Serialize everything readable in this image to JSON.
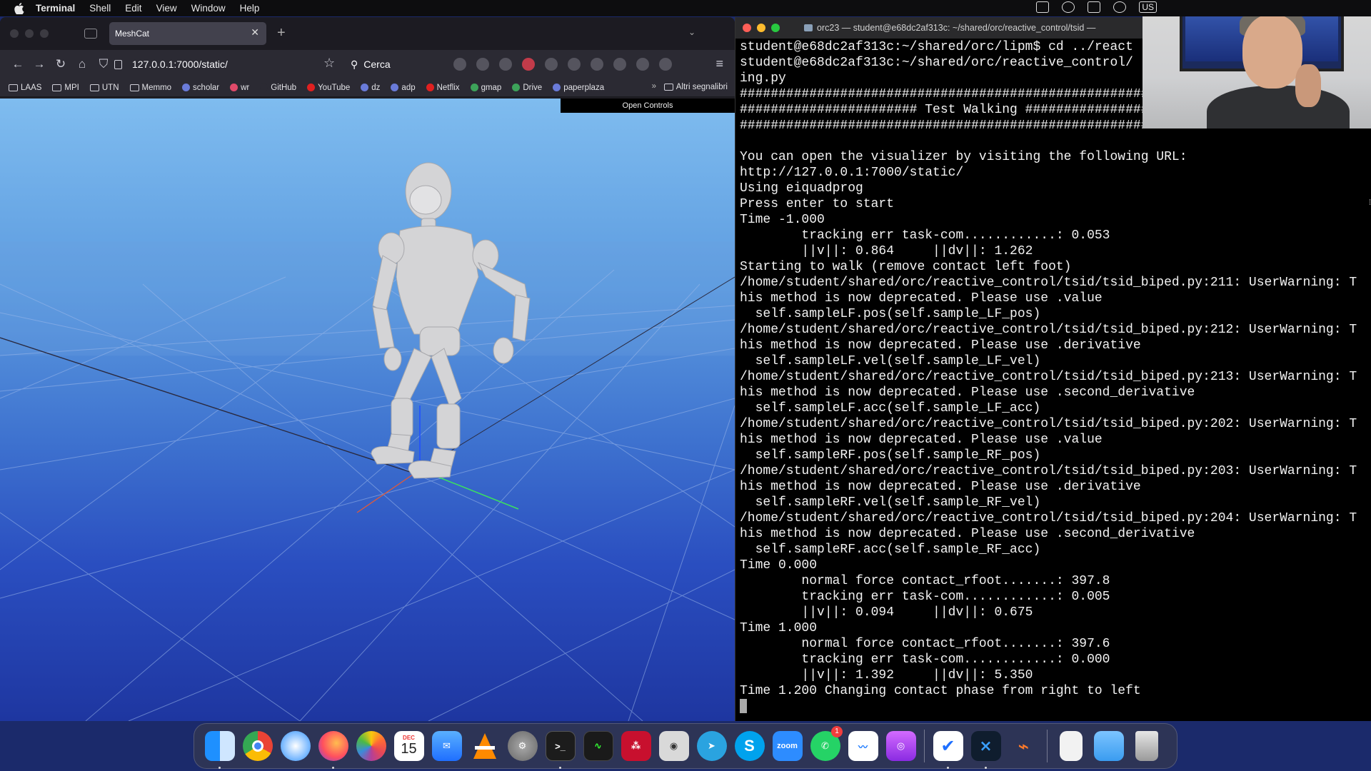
{
  "menubar": {
    "app_name": "Terminal",
    "items": [
      "Shell",
      "Edit",
      "View",
      "Window",
      "Help"
    ],
    "input_source": "US"
  },
  "browser": {
    "tab_title": "MeshCat",
    "url": "127.0.0.1:7000/static/",
    "search_placeholder": "Cerca",
    "bookmarks": [
      "LAAS",
      "MPI",
      "UTN",
      "Memmo",
      "scholar",
      "wr",
      "GitHub",
      "YouTube",
      "dz",
      "adp",
      "Netflix",
      "gmap",
      "Drive",
      "paperplaza"
    ],
    "other_bookmarks": "Altri segnalibri",
    "open_controls": "Open Controls"
  },
  "terminal": {
    "title": "orc23 — student@e68dc2af313c: ~/shared/orc/reactive_control/tsid —",
    "lines": [
      "student@e68dc2af313c:~/shared/orc/lipm$ cd ../react",
      "student@e68dc2af313c:~/shared/orc/reactive_control/",
      "ing.py",
      "##########################################################",
      "####################### Test Walking #####################",
      "##########################################################",
      "",
      "You can open the visualizer by visiting the following URL:",
      "http://127.0.0.1:7000/static/",
      "Using eiquadprog",
      "Press enter to start",
      "Time -1.000",
      "        tracking err task-com............: 0.053",
      "        ||v||: 0.864     ||dv||: 1.262",
      "Starting to walk (remove contact left foot)",
      "/home/student/shared/orc/reactive_control/tsid/tsid_biped.py:211: UserWarning: T",
      "his method is now deprecated. Please use .value",
      "  self.sampleLF.pos(self.sample_LF_pos)",
      "/home/student/shared/orc/reactive_control/tsid/tsid_biped.py:212: UserWarning: T",
      "his method is now deprecated. Please use .derivative",
      "  self.sampleLF.vel(self.sample_LF_vel)",
      "/home/student/shared/orc/reactive_control/tsid/tsid_biped.py:213: UserWarning: T",
      "his method is now deprecated. Please use .second_derivative",
      "  self.sampleLF.acc(self.sample_LF_acc)",
      "/home/student/shared/orc/reactive_control/tsid/tsid_biped.py:202: UserWarning: T",
      "his method is now deprecated. Please use .value",
      "  self.sampleRF.pos(self.sample_RF_pos)",
      "/home/student/shared/orc/reactive_control/tsid/tsid_biped.py:203: UserWarning: T",
      "his method is now deprecated. Please use .derivative",
      "  self.sampleRF.vel(self.sample_RF_vel)",
      "/home/student/shared/orc/reactive_control/tsid/tsid_biped.py:204: UserWarning: T",
      "his method is now deprecated. Please use .second_derivative",
      "  self.sampleRF.acc(self.sample_RF_acc)",
      "Time 0.000",
      "        normal force contact_rfoot.......: 397.8",
      "        tracking err task-com............: 0.005",
      "        ||v||: 0.094     ||dv||: 0.675",
      "Time 1.000",
      "        normal force contact_rfoot.......: 397.6",
      "        tracking err task-com............: 0.000",
      "        ||v||: 1.392     ||dv||: 5.350",
      "Time 1.200 Changing contact phase from right to left"
    ]
  },
  "dock": {
    "calendar_month": "DEC",
    "calendar_day": "15",
    "whatsapp_badge": "1",
    "zoom_label": "zoom",
    "apps": [
      "finder-icon",
      "chrome-icon",
      "safari-icon",
      "firefox-icon",
      "photos-icon",
      "calendar-icon",
      "mail-icon",
      "vlc-icon",
      "system-settings-icon",
      "terminal-icon",
      "activity-monitor-icon",
      "mendeley-icon",
      "screenshot-icon",
      "telegram-icon",
      "skype-icon",
      "zoom-icon",
      "whatsapp-icon",
      "freeform-icon",
      "podcasts-icon",
      "tasks-icon",
      "vscode-icon",
      "instruments-icon",
      "documents-icon",
      "downloads-folder-icon",
      "trash-icon"
    ]
  },
  "colors": {
    "sky_top": "#7fbcef",
    "floor_bottom": "#1e36a0",
    "terminal_bg": "#000000"
  }
}
